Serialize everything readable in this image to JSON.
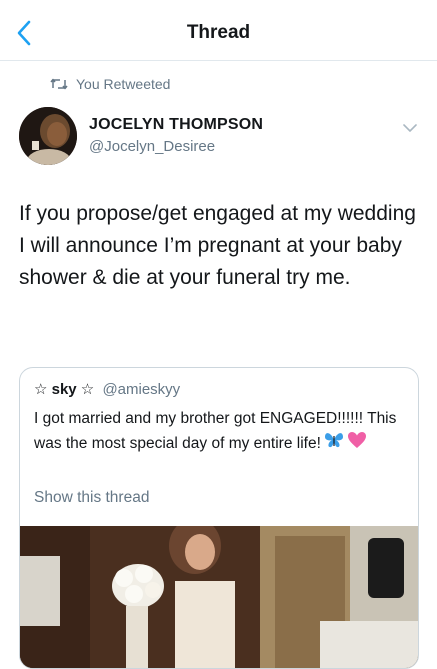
{
  "nav": {
    "title": "Thread"
  },
  "retweet": {
    "label": "You Retweeted"
  },
  "tweet": {
    "author_name": "JOCELYN THOMPSON",
    "author_handle": "@Jocelyn_Desiree",
    "text": "If you propose/get engaged at my wedding I will announce I’m pregnant at your baby shower & die at your funeral try me."
  },
  "quoted": {
    "author_name": "☆ sky ☆",
    "author_handle": "@amieskyy",
    "text": "I got married and my brother got ENGAGED!!!!!! This was the most special day of my entire life!",
    "show_thread": "Show this thread",
    "emojis": [
      "blue-butterfly",
      "pink-heart"
    ]
  },
  "colors": {
    "text": "#14171a",
    "secondary": "#657786",
    "link": "#1da1f2",
    "border": "#ccd6dd"
  }
}
